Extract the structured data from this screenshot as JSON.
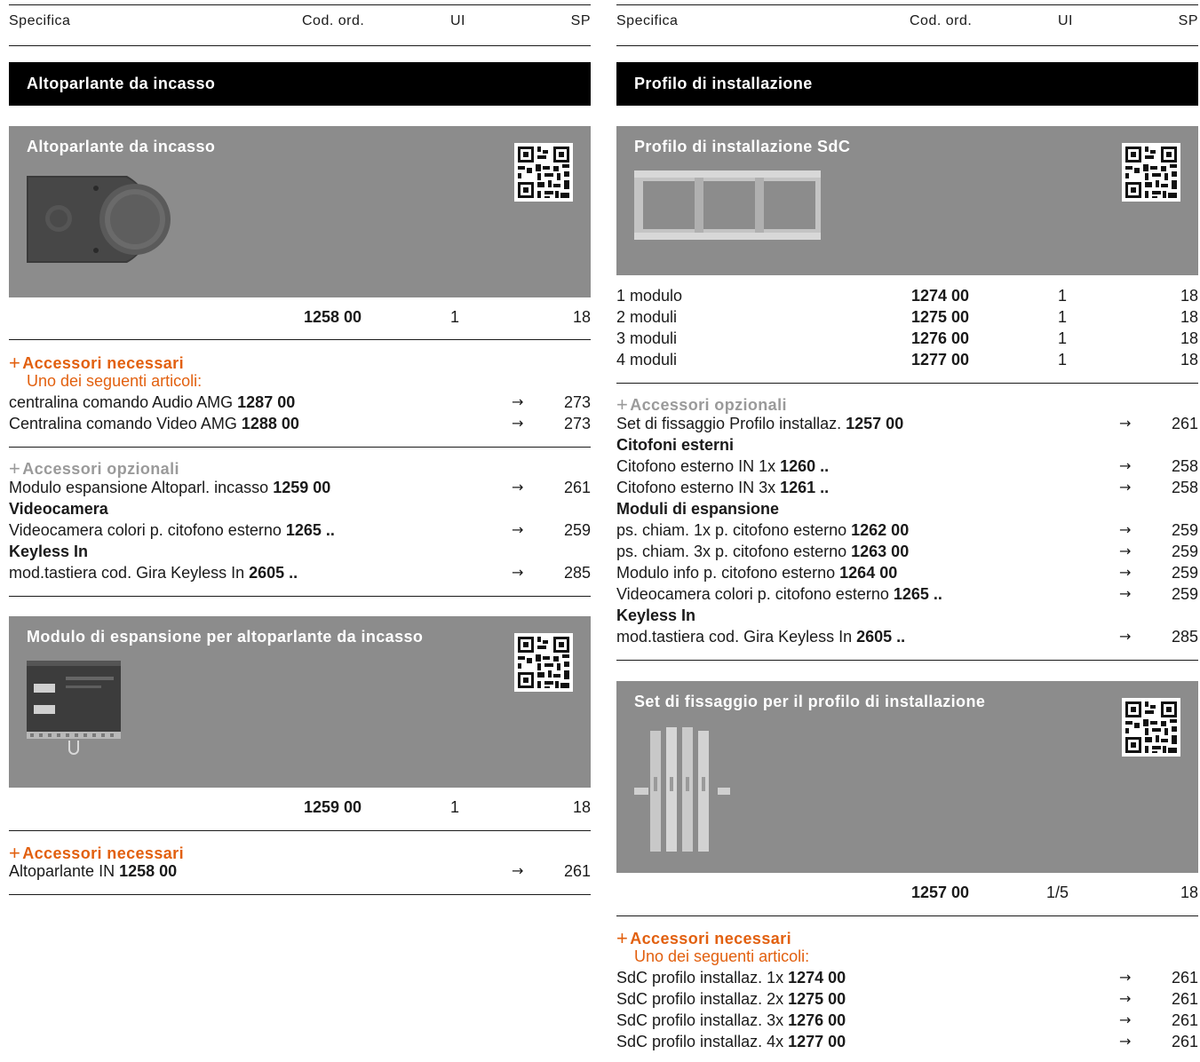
{
  "header": {
    "spec": "Specifica",
    "cod": "Cod. ord.",
    "ui": "UI",
    "sp": "SP"
  },
  "left": {
    "section_title": "Altoparlante da incasso",
    "product1": {
      "title": "Altoparlante da incasso",
      "code": "1258 00",
      "ui": "1",
      "sp": "18",
      "required_title": "Accessori necessari",
      "required_sub": "Uno dei seguenti articoli:",
      "required": [
        {
          "text": "centralina comando Audio AMG ",
          "code": "1287 00",
          "arrow": "→",
          "page": "273"
        },
        {
          "text": "Centralina comando Video AMG ",
          "code": "1288 00",
          "arrow": "→",
          "page": "273"
        }
      ],
      "optional_title": "Accessori opzionali",
      "optional": [
        {
          "text": "Modulo espansione Altoparl. incasso ",
          "code": "1259 00",
          "arrow": "→",
          "page": "261"
        }
      ],
      "group1_title": "Videocamera",
      "group1": [
        {
          "text": "Videocamera colori p. citofono esterno ",
          "code": "1265 ..",
          "arrow": "→",
          "page": "259"
        }
      ],
      "group2_title": "Keyless In",
      "group2": [
        {
          "text": "mod.tastiera cod. Gira Keyless In ",
          "code": "2605 ..",
          "arrow": "→",
          "page": "285"
        }
      ]
    },
    "product2": {
      "title": "Modulo di espansione per altoparlante da incasso",
      "code": "1259 00",
      "ui": "1",
      "sp": "18",
      "required_title": "Accessori necessari",
      "required": [
        {
          "text": "Altoparlante IN ",
          "code": "1258 00",
          "arrow": "→",
          "page": "261"
        }
      ]
    }
  },
  "right": {
    "section_title": "Profilo di installazione",
    "product1": {
      "title": "Profilo di installazione SdC",
      "variants": [
        {
          "spec": "1 modulo",
          "code": "1274 00",
          "ui": "1",
          "sp": "18"
        },
        {
          "spec": "2 moduli",
          "code": "1275 00",
          "ui": "1",
          "sp": "18"
        },
        {
          "spec": "3 moduli",
          "code": "1276 00",
          "ui": "1",
          "sp": "18"
        },
        {
          "spec": "4 moduli",
          "code": "1277 00",
          "ui": "1",
          "sp": "18"
        }
      ],
      "optional_title": "Accessori opzionali",
      "optional": [
        {
          "text": "Set di fissaggio Profilo installaz. ",
          "code": "1257 00",
          "arrow": "→",
          "page": "261"
        }
      ],
      "group1_title": "Citofoni esterni",
      "group1": [
        {
          "text": "Citofono esterno IN 1x ",
          "code": "1260 ..",
          "arrow": "→",
          "page": "258"
        },
        {
          "text": "Citofono esterno IN 3x ",
          "code": "1261 ..",
          "arrow": "→",
          "page": "258"
        }
      ],
      "group2_title": "Moduli di espansione",
      "group2": [
        {
          "text": "ps. chiam. 1x p. citofono esterno ",
          "code": "1262 00",
          "arrow": "→",
          "page": "259"
        },
        {
          "text": "ps. chiam. 3x p. citofono esterno ",
          "code": "1263 00",
          "arrow": "→",
          "page": "259"
        },
        {
          "text": "Modulo info p. citofono esterno ",
          "code": "1264 00",
          "arrow": "→",
          "page": "259"
        },
        {
          "text": "Videocamera colori p. citofono esterno ",
          "code": "1265 ..",
          "arrow": "→",
          "page": "259"
        }
      ],
      "group3_title": "Keyless In",
      "group3": [
        {
          "text": "mod.tastiera cod. Gira Keyless In ",
          "code": "2605 ..",
          "arrow": "→",
          "page": "285"
        }
      ]
    },
    "product2": {
      "title": "Set di fissaggio per il profilo di installazione",
      "code": "1257 00",
      "ui": "1/5",
      "sp": "18",
      "required_title": "Accessori necessari",
      "required_sub": "Uno dei seguenti articoli:",
      "required": [
        {
          "text": "SdC profilo installaz. 1x ",
          "code": "1274 00",
          "arrow": "→",
          "page": "261"
        },
        {
          "text": "SdC profilo installaz. 2x ",
          "code": "1275 00",
          "arrow": "→",
          "page": "261"
        },
        {
          "text": "SdC profilo installaz. 3x ",
          "code": "1276 00",
          "arrow": "→",
          "page": "261"
        },
        {
          "text": "SdC profilo installaz. 4x ",
          "code": "1277 00",
          "arrow": "→",
          "page": "261"
        }
      ]
    }
  }
}
